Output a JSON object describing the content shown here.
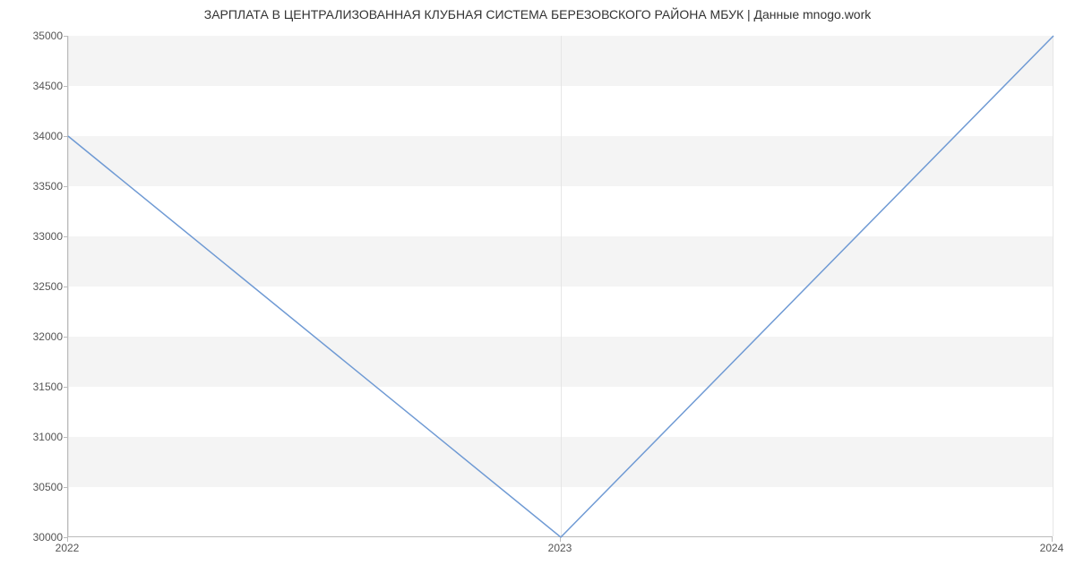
{
  "chart_data": {
    "type": "line",
    "title": "ЗАРПЛАТА В ЦЕНТРАЛИЗОВАННАЯ КЛУБНАЯ СИСТЕМА БЕРЕЗОВСКОГО РАЙОНА МБУК | Данные mnogo.work",
    "xlabel": "",
    "ylabel": "",
    "x": [
      2022,
      2023,
      2024
    ],
    "values": [
      34000,
      30000,
      35000
    ],
    "ylim": [
      30000,
      35000
    ],
    "y_ticks": [
      30000,
      30500,
      31000,
      31500,
      32000,
      32500,
      33000,
      33500,
      34000,
      34500,
      35000
    ],
    "x_ticks": [
      2022,
      2023,
      2024
    ],
    "line_color": "#6f9ad4",
    "band_color": "#f4f4f4"
  }
}
